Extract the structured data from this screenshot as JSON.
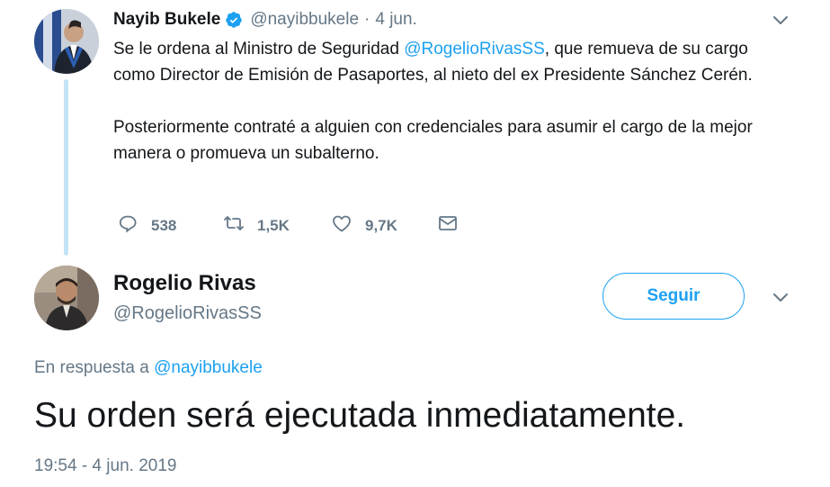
{
  "parent_tweet": {
    "name": "Nayib Bukele",
    "handle": "@nayibbukele",
    "separator": "·",
    "time": "4 jun.",
    "text_1_before": "Se le ordena al Ministro de Seguridad ",
    "text_1_mention": "@RogelioRivasSS",
    "text_1_after": ", que remueva de su cargo como Director de Emisión de Pasaportes, al nieto del ex Presidente Sánchez Cerén.",
    "text_2": "Posteriormente contraté a alguien con credenciales para asumir el cargo de la mejor manera o promueva un subalterno.",
    "replies": "538",
    "retweets": "1,5K",
    "likes": "9,7K"
  },
  "reply_tweet": {
    "name": "Rogelio Rivas",
    "handle": "@RogelioRivasSS",
    "follow_label": "Seguir",
    "in_reply_prefix": "En respuesta a ",
    "in_reply_handle": "@nayibbukele",
    "text": "Su orden será ejecutada inmediatamente.",
    "timestamp": "19:54 - 4 jun. 2019"
  },
  "colors": {
    "accent": "#1da1f2",
    "secondary_text": "#657786",
    "thread_line": "#c5e3f6",
    "primary_text": "#14171a"
  },
  "icons": [
    "verified-badge-icon",
    "chevron-down-icon",
    "reply-icon",
    "retweet-icon",
    "like-icon",
    "direct-message-icon"
  ]
}
